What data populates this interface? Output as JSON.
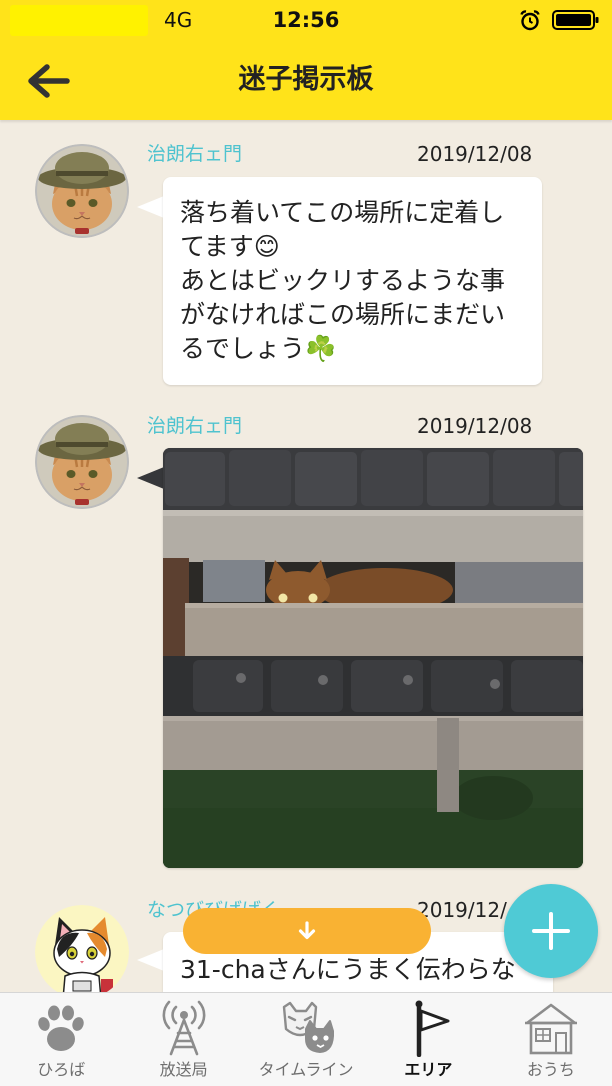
{
  "status_bar": {
    "network": "4G",
    "time": "12:56",
    "icons": [
      "alarm-clock-icon",
      "battery-icon"
    ]
  },
  "header": {
    "back_icon": "arrow-left-icon",
    "title": "迷子掲示板"
  },
  "posts": [
    {
      "author": "治朗右ェ門",
      "date": "2019/12/08",
      "message_lines": [
        "落ち着いてこの場所に定着し",
        "てます😊",
        "あとはビックリするような事",
        "がなければこの場所にまだい",
        "るでしょう☘️"
      ]
    },
    {
      "author": "治朗右ェ門",
      "date": "2019/12/08"
    },
    {
      "author": "なつびびばばく",
      "date": "2019/12/",
      "message_lines": [
        "31-chaさんにうまく伝わらな"
      ]
    }
  ],
  "scroll_down_button": {
    "icon": "arrow-down-icon"
  },
  "compose_fab": {
    "icon": "plus-icon"
  },
  "tab_bar": {
    "items": [
      {
        "label": "ひろば",
        "icon": "paw-icon",
        "active": false
      },
      {
        "label": "放送局",
        "icon": "broadcast-tower-icon",
        "active": false
      },
      {
        "label": "タイムライン",
        "icon": "cat-faces-icon",
        "active": false
      },
      {
        "label": "エリア",
        "icon": "flag-icon",
        "active": true
      },
      {
        "label": "おうち",
        "icon": "house-icon",
        "active": false
      }
    ]
  },
  "colors": {
    "header_yellow": "#FFE31A",
    "background": "#F2ECE1",
    "author_teal": "#4FC3CF",
    "scroll_button_orange": "#F9B233",
    "fab_teal": "#4FCAD5",
    "tab_inactive": "#8C8C8C",
    "tab_active": "#222222"
  }
}
